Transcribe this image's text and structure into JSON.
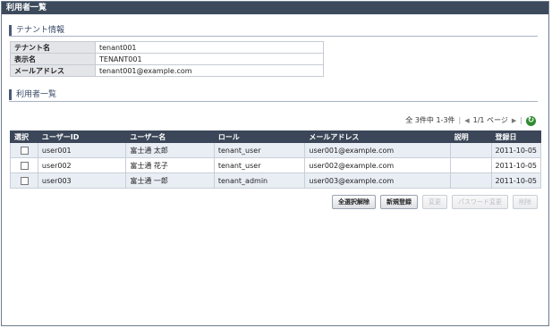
{
  "window": {
    "title": "利用者一覧"
  },
  "tenant_section": {
    "heading": "テナント情報",
    "rows": [
      {
        "label": "テナント名",
        "value": "tenant001"
      },
      {
        "label": "表示名",
        "value": "TENANT001"
      },
      {
        "label": "メールアドレス",
        "value": "tenant001@example.com"
      }
    ]
  },
  "user_section": {
    "heading": "利用者一覧",
    "pager": {
      "summary": "全 3件中 1-3件",
      "page": "1/1 ページ"
    },
    "columns": [
      "選択",
      "ユーザーID",
      "ユーザー名",
      "ロール",
      "メールアドレス",
      "説明",
      "登録日"
    ],
    "rows": [
      {
        "id": "user001",
        "name": "富士通 太郎",
        "role": "tenant_user",
        "email": "user001@example.com",
        "description": "",
        "date": "2011-10-05"
      },
      {
        "id": "user002",
        "name": "富士通 花子",
        "role": "tenant_user",
        "email": "user002@example.com",
        "description": "",
        "date": "2011-10-05"
      },
      {
        "id": "user003",
        "name": "富士通 一郎",
        "role": "tenant_admin",
        "email": "user003@example.com",
        "description": "",
        "date": "2011-10-05"
      }
    ]
  },
  "buttons": {
    "select_all_clear": "全選択解除",
    "new_register": "新規登録",
    "change": "変更",
    "password_change": "パスワード変更",
    "delete": "削除"
  }
}
